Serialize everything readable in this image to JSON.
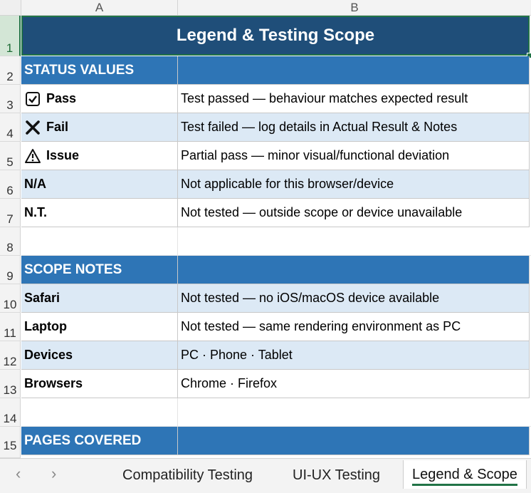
{
  "columns": [
    "A",
    "B"
  ],
  "row_numbers": [
    "1",
    "2",
    "3",
    "4",
    "5",
    "6",
    "7",
    "8",
    "9",
    "10",
    "11",
    "12",
    "13",
    "14",
    "15"
  ],
  "title": "Legend & Testing Scope",
  "sections": {
    "status": "STATUS VALUES",
    "scope": "SCOPE NOTES",
    "pages": "PAGES COVERED"
  },
  "status_rows": [
    {
      "icon": "check-box-icon",
      "label": "Pass",
      "desc": "Test passed — behaviour matches expected result"
    },
    {
      "icon": "x-mark-icon",
      "label": "Fail",
      "desc": "Test failed — log details in Actual Result & Notes"
    },
    {
      "icon": "warning-icon",
      "label": "Issue",
      "desc": "Partial pass — minor visual/functional deviation"
    },
    {
      "label": "N/A",
      "desc": "Not applicable for this browser/device"
    },
    {
      "label": "N.T.",
      "desc": "Not tested — outside scope or device unavailable"
    }
  ],
  "scope_rows": [
    {
      "label": "Safari",
      "desc": "Not tested — no iOS/macOS device available"
    },
    {
      "label": "Laptop",
      "desc": "Not tested — same rendering environment as PC"
    },
    {
      "label": "Devices",
      "desc": "PC · Phone · Tablet"
    },
    {
      "label": "Browsers",
      "desc": "Chrome · Firefox"
    }
  ],
  "tabs": [
    "Compatibility Testing",
    "UI-UX Testing",
    "Legend & Scope"
  ],
  "active_tab": "Legend & Scope",
  "colors": {
    "title_bg": "#1f4e79",
    "section_bg": "#2e75b6",
    "alt_row": "#dce9f5",
    "accent": "#217346"
  }
}
